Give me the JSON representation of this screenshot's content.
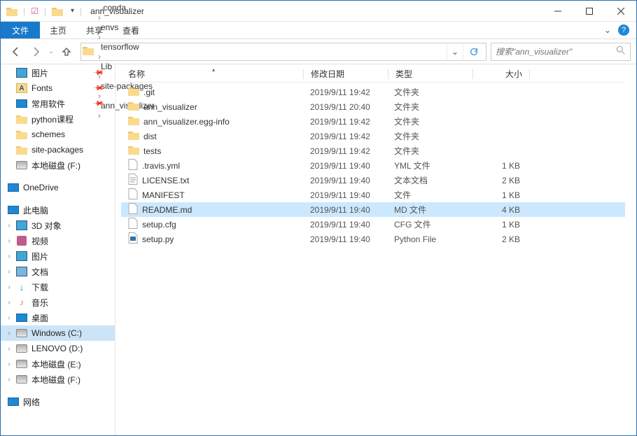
{
  "titlebar": {
    "title": "ann_visualizer"
  },
  "ribbon": {
    "file": "文件",
    "tabs": [
      "主页",
      "共享",
      "查看"
    ]
  },
  "breadcrumbs": [
    "«",
    ".conda",
    "envs",
    "tensorflow",
    "Lib",
    "site-packages",
    "ann_visualizer"
  ],
  "search": {
    "placeholder": "搜索\"ann_visualizer\""
  },
  "columns": {
    "name": "名称",
    "date": "修改日期",
    "type": "类型",
    "size": "大小"
  },
  "sidebar": {
    "quick": [
      {
        "label": "图片",
        "icon": "pictures",
        "pinned": true
      },
      {
        "label": "Fonts",
        "icon": "fonts",
        "pinned": true
      },
      {
        "label": "常用软件",
        "icon": "apps",
        "pinned": true
      },
      {
        "label": "python课程",
        "icon": "folder",
        "pinned": false
      },
      {
        "label": "schemes",
        "icon": "folder",
        "pinned": false
      },
      {
        "label": "site-packages",
        "icon": "folder",
        "pinned": false
      },
      {
        "label": "本地磁盘 (F:)",
        "icon": "drive",
        "pinned": false
      }
    ],
    "onedrive": "OneDrive",
    "thispc": {
      "label": "此电脑",
      "items": [
        {
          "label": "3D 对象",
          "icon": "3d"
        },
        {
          "label": "视频",
          "icon": "video"
        },
        {
          "label": "图片",
          "icon": "pictures"
        },
        {
          "label": "文档",
          "icon": "docs"
        },
        {
          "label": "下载",
          "icon": "downloads"
        },
        {
          "label": "音乐",
          "icon": "music"
        },
        {
          "label": "桌面",
          "icon": "desktop"
        },
        {
          "label": "Windows (C:)",
          "icon": "drive",
          "selected": true
        },
        {
          "label": "LENOVO (D:)",
          "icon": "drive"
        },
        {
          "label": "本地磁盘 (E:)",
          "icon": "drive"
        },
        {
          "label": "本地磁盘 (F:)",
          "icon": "drive"
        }
      ]
    },
    "network": "网络"
  },
  "files": [
    {
      "name": ".git",
      "date": "2019/9/11 19:42",
      "type": "文件夹",
      "size": "",
      "icon": "folder"
    },
    {
      "name": "ann_visualizer",
      "date": "2019/9/11 20:40",
      "type": "文件夹",
      "size": "",
      "icon": "folder"
    },
    {
      "name": "ann_visualizer.egg-info",
      "date": "2019/9/11 19:42",
      "type": "文件夹",
      "size": "",
      "icon": "folder"
    },
    {
      "name": "dist",
      "date": "2019/9/11 19:42",
      "type": "文件夹",
      "size": "",
      "icon": "folder"
    },
    {
      "name": "tests",
      "date": "2019/9/11 19:42",
      "type": "文件夹",
      "size": "",
      "icon": "folder"
    },
    {
      "name": ".travis.yml",
      "date": "2019/9/11 19:40",
      "type": "YML 文件",
      "size": "1 KB",
      "icon": "file"
    },
    {
      "name": "LICENSE.txt",
      "date": "2019/9/11 19:40",
      "type": "文本文档",
      "size": "2 KB",
      "icon": "txt"
    },
    {
      "name": "MANIFEST",
      "date": "2019/9/11 19:40",
      "type": "文件",
      "size": "1 KB",
      "icon": "file"
    },
    {
      "name": "README.md",
      "date": "2019/9/11 19:40",
      "type": "MD 文件",
      "size": "4 KB",
      "icon": "file",
      "selected": true
    },
    {
      "name": "setup.cfg",
      "date": "2019/9/11 19:40",
      "type": "CFG 文件",
      "size": "1 KB",
      "icon": "file"
    },
    {
      "name": "setup.py",
      "date": "2019/9/11 19:40",
      "type": "Python File",
      "size": "2 KB",
      "icon": "py"
    }
  ]
}
